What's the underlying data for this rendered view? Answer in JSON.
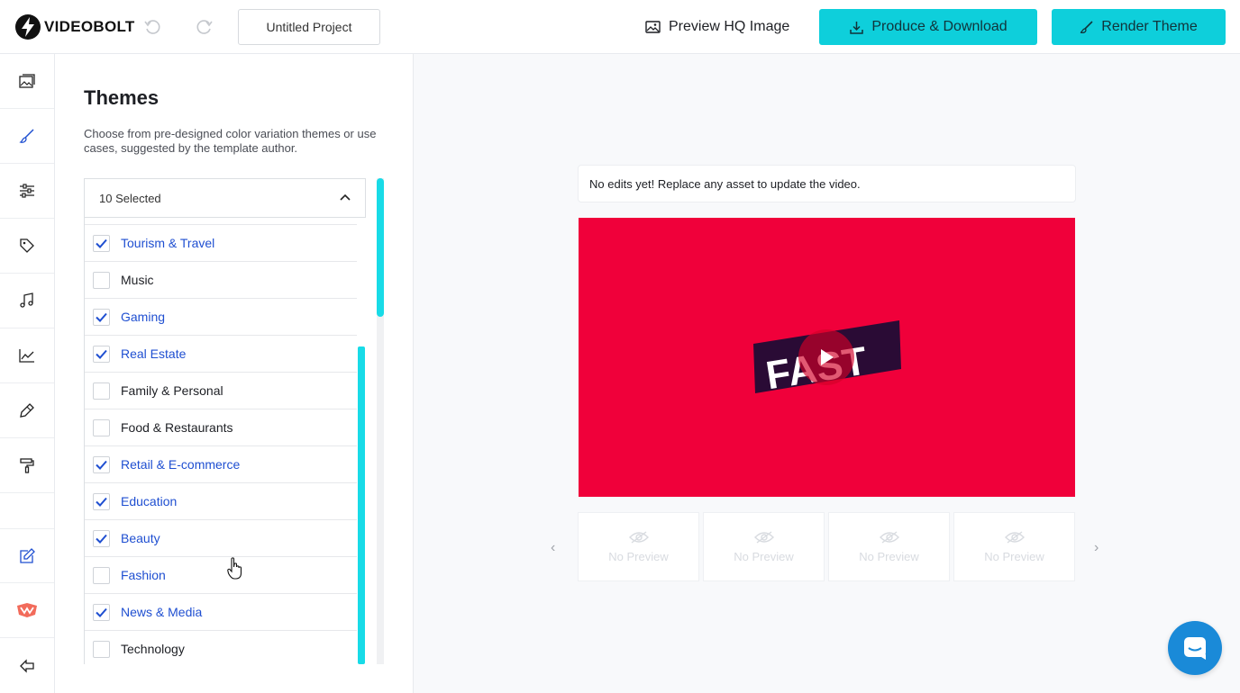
{
  "app": {
    "logo_text": "VIDEOBOLT",
    "project_name": "Untitled Project",
    "preview_hq_label": "Preview HQ Image",
    "produce_label": "Produce & Download",
    "render_label": "Render Theme",
    "accent": "#0ecfdb",
    "link_blue": "#1f4fd1"
  },
  "nav": {
    "items": [
      {
        "icon": "media-icon"
      },
      {
        "icon": "brush-icon"
      },
      {
        "icon": "sliders-icon"
      },
      {
        "icon": "tag-icon"
      },
      {
        "icon": "music-icon"
      },
      {
        "icon": "chart-icon"
      },
      {
        "icon": "pen-icon"
      },
      {
        "icon": "paint-roller-icon"
      },
      {
        "icon": "edit-icon"
      },
      {
        "icon": "brand-logo-icon"
      },
      {
        "icon": "exit-icon"
      }
    ]
  },
  "themes": {
    "title": "Themes",
    "description": "Choose from pre-designed color variation themes or use cases, suggested by the template author.",
    "selected_label": "10 Selected",
    "options": [
      {
        "label": "Tourism & Travel",
        "checked": true
      },
      {
        "label": "Music",
        "checked": false
      },
      {
        "label": "Gaming",
        "checked": true
      },
      {
        "label": "Real Estate",
        "checked": true
      },
      {
        "label": "Family & Personal",
        "checked": false
      },
      {
        "label": "Food & Restaurants",
        "checked": false
      },
      {
        "label": "Retail & E-commerce",
        "checked": true
      },
      {
        "label": "Education",
        "checked": true
      },
      {
        "label": "Beauty",
        "checked": true
      },
      {
        "label": "Fashion",
        "checked": false,
        "hover": true
      },
      {
        "label": "News & Media",
        "checked": true
      },
      {
        "label": "Technology",
        "checked": false
      }
    ]
  },
  "preview": {
    "notice": "No edits yet! Replace any asset to update the video.",
    "video_color": "#f0003a",
    "video_logo_text": "FAST",
    "thumbs": [
      {
        "label": "No Preview"
      },
      {
        "label": "No Preview"
      },
      {
        "label": "No Preview"
      },
      {
        "label": "No Preview"
      }
    ]
  }
}
